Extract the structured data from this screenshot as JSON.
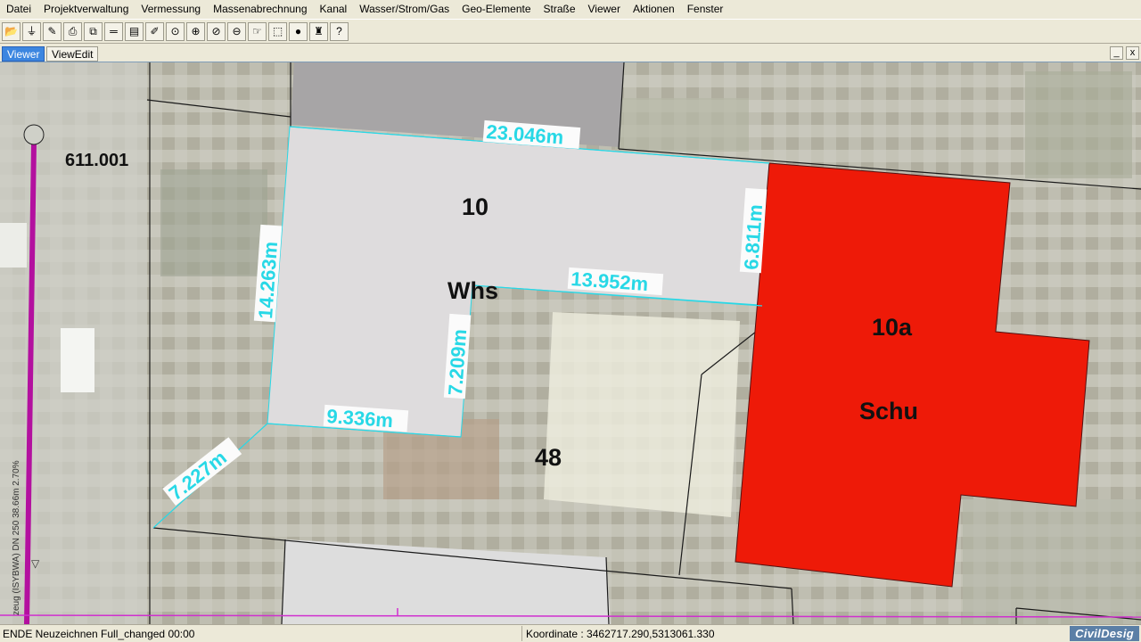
{
  "menu": [
    "Datei",
    "Projektverwaltung",
    "Vermessung",
    "Massenabrechnung",
    "Kanal",
    "Wasser/Strom/Gas",
    "Geo-Elemente",
    "Straße",
    "Viewer",
    "Aktionen",
    "Fenster"
  ],
  "toolbar": [
    {
      "name": "open-folder-icon",
      "glyph": "📂"
    },
    {
      "name": "filter-icon",
      "glyph": "⏚"
    },
    {
      "name": "layer-settings-icon",
      "glyph": "✎"
    },
    {
      "name": "print-icon",
      "glyph": "⎙"
    },
    {
      "name": "copy-icon",
      "glyph": "⧉"
    },
    {
      "name": "measure-icon",
      "glyph": "═"
    },
    {
      "name": "table-icon",
      "glyph": "▤"
    },
    {
      "name": "edit-icon",
      "glyph": "✐"
    },
    {
      "name": "zoom-icon",
      "glyph": "⊙"
    },
    {
      "name": "zoom-in-icon",
      "glyph": "⊕"
    },
    {
      "name": "zoom-window-icon",
      "glyph": "⊘"
    },
    {
      "name": "zoom-out-icon",
      "glyph": "⊖"
    },
    {
      "name": "pan-icon",
      "glyph": "☞"
    },
    {
      "name": "select-icon",
      "glyph": "⬚"
    },
    {
      "name": "highlight-icon",
      "glyph": "●"
    },
    {
      "name": "tool-icon",
      "glyph": "♜"
    },
    {
      "name": "help-icon",
      "glyph": "?"
    }
  ],
  "tabs": {
    "viewer": "Viewer",
    "viewedit": "ViewEdit"
  },
  "window_buttons": {
    "minimize": "_",
    "close": "x"
  },
  "map": {
    "parcel_number": "611.001",
    "labels": {
      "house_number_10": "10",
      "building_whs": "Whs",
      "house_number_10a": "10a",
      "building_schu": "Schu",
      "house_number_48": "48"
    },
    "dimensions": {
      "top": "23.046m",
      "left": "14.263m",
      "right": "6.811m",
      "middle": "13.952m",
      "inner": "7.209m",
      "bottom": "9.336m",
      "diagonal": "7.227m"
    },
    "pipe_label": "zeug (ISYBWA) DN 250 38.66m 2.70%",
    "colors": {
      "pipe": "#b3109f",
      "dimension": "#28d8e6",
      "red_building": "#ee1a08",
      "grey_building": "#dedcdd"
    }
  },
  "status": {
    "left": "ENDE Neuzeichnen Full_changed  00:00",
    "coordinate": "Koordinate : 3462717.290,5313061.330",
    "logo": "CivilDesig"
  }
}
